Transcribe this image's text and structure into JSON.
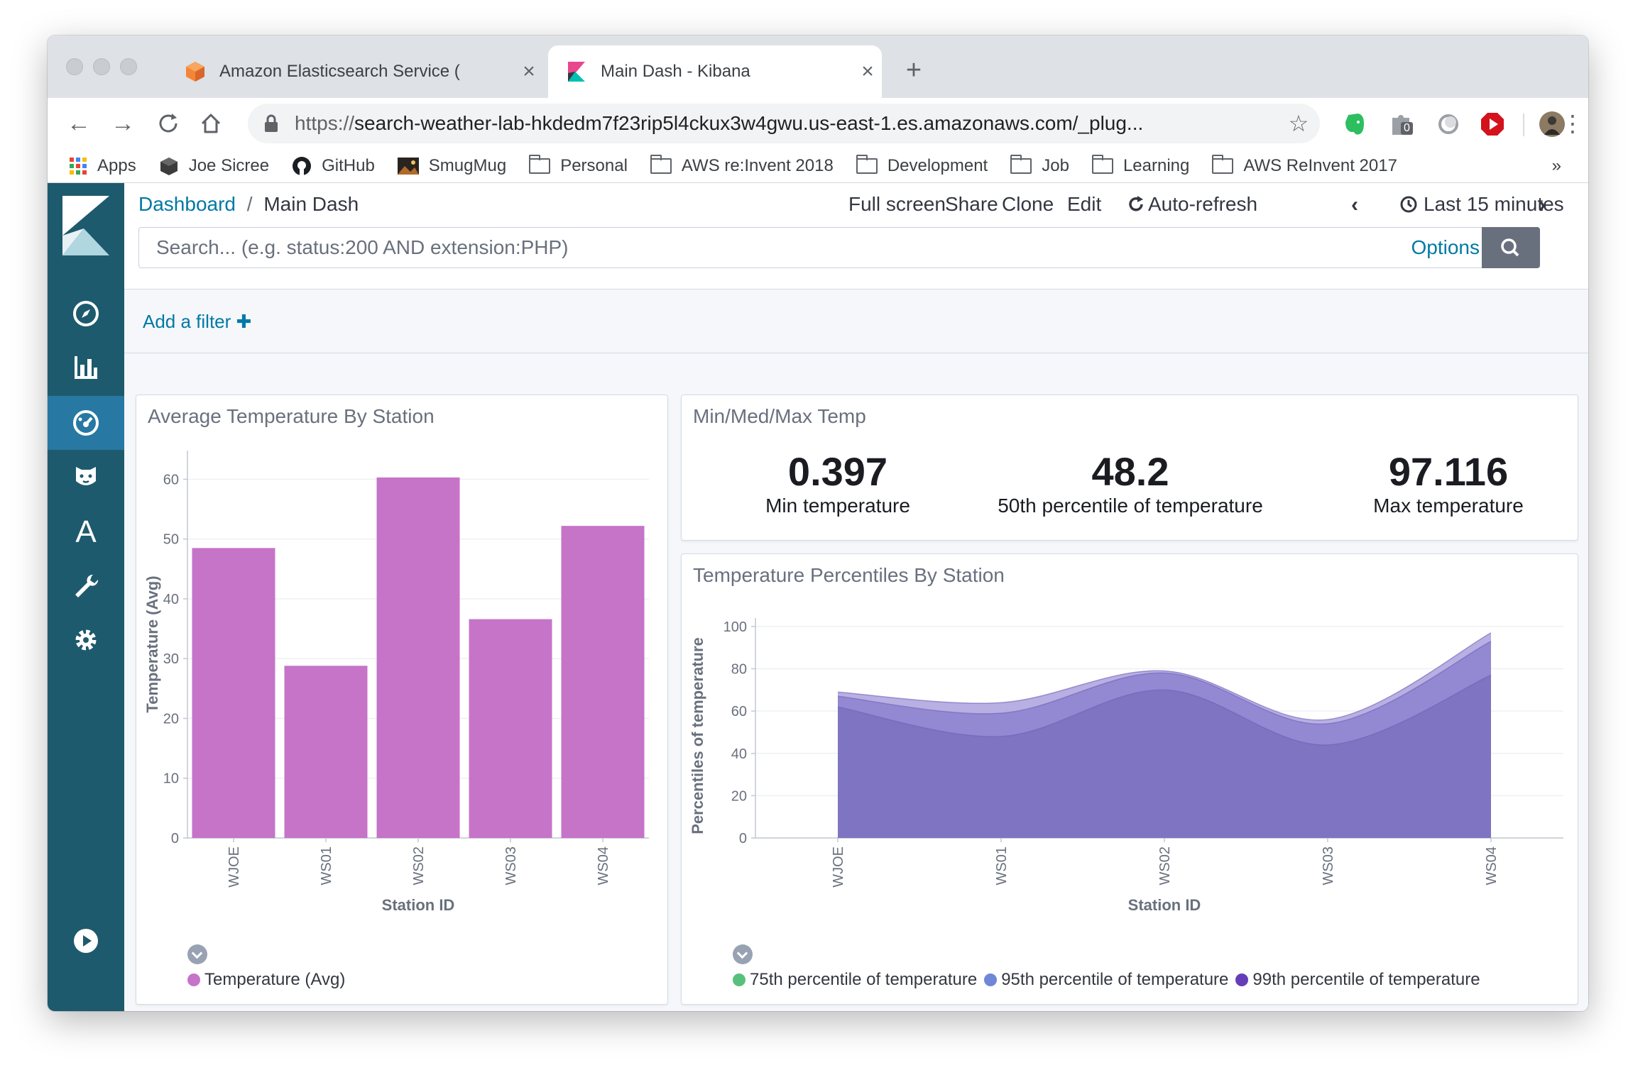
{
  "browser": {
    "tabs": [
      {
        "title": "Amazon Elasticsearch Service (",
        "active": false
      },
      {
        "title": "Main Dash - Kibana",
        "active": true
      }
    ],
    "url_scheme": "https://",
    "url_rest": "search-weather-lab-hkdedm7f23rip5l4ckux3w4gwu.us-east-1.es.amazonaws.com/_plug...",
    "extension_badge": "0",
    "bookmarks": [
      {
        "label": "Apps",
        "icon": "apps-grid-icon"
      },
      {
        "label": "Joe Sicree",
        "icon": "cube-icon"
      },
      {
        "label": "GitHub",
        "icon": "github-icon"
      },
      {
        "label": "SmugMug",
        "icon": "photo-icon"
      },
      {
        "label": "Personal",
        "icon": "folder-icon"
      },
      {
        "label": "AWS re:Invent 2018",
        "icon": "folder-icon"
      },
      {
        "label": "Development",
        "icon": "folder-icon"
      },
      {
        "label": "Job",
        "icon": "folder-icon"
      },
      {
        "label": "Learning",
        "icon": "folder-icon"
      },
      {
        "label": "AWS ReInvent 2017",
        "icon": "folder-icon"
      }
    ],
    "overflow": "»"
  },
  "kibana": {
    "breadcrumb": {
      "root": "Dashboard",
      "sep": "/",
      "current": "Main Dash"
    },
    "menu": {
      "full_screen": "Full screen",
      "share": "Share",
      "clone": "Clone",
      "edit": "Edit",
      "auto_refresh": "Auto-refresh",
      "time_range": "Last 15 minutes"
    },
    "search": {
      "placeholder": "Search... (e.g. status:200 AND extension:PHP)",
      "options": "Options"
    },
    "add_filter": "Add a filter",
    "colors": {
      "sidebar": "#1e5a6d",
      "accent": "#0079a5",
      "bar": "#c574c8",
      "area": "#8a7fcc"
    }
  },
  "panels": {
    "avg_temp": {
      "title": "Average Temperature By Station",
      "legend": "Temperature (Avg)",
      "legend_color": "#c574c8"
    },
    "metrics": {
      "title": "Min/Med/Max Temp",
      "items": [
        {
          "value": "0.397",
          "label": "Min temperature"
        },
        {
          "value": "48.2",
          "label": "50th percentile of temperature"
        },
        {
          "value": "97.116",
          "label": "Max temperature"
        }
      ]
    },
    "percentiles": {
      "title": "Temperature Percentiles By Station",
      "legend": [
        {
          "label": "75th percentile of temperature",
          "color": "#57c17b"
        },
        {
          "label": "95th percentile of temperature",
          "color": "#6f87d8"
        },
        {
          "label": "99th percentile of temperature",
          "color": "#663db8"
        }
      ]
    }
  },
  "chart_data": [
    {
      "type": "bar",
      "categories": [
        "WJOE",
        "WS01",
        "WS02",
        "WS03",
        "WS04"
      ],
      "values": [
        48.5,
        28.8,
        60.3,
        36.6,
        52.2
      ],
      "xlabel": "Station ID",
      "ylabel": "Temperature (Avg)",
      "ylim": [
        0,
        60
      ],
      "yticks": [
        0,
        10,
        20,
        30,
        40,
        50,
        60
      ],
      "grid": true,
      "color": "#c574c8"
    },
    {
      "type": "area",
      "categories": [
        "WJOE",
        "WS01",
        "WS02",
        "WS03",
        "WS04"
      ],
      "series": [
        {
          "name": "75th percentile of temperature",
          "values": [
            62,
            48,
            70,
            44,
            77
          ]
        },
        {
          "name": "95th percentile of temperature",
          "values": [
            67,
            59,
            78,
            54,
            93
          ]
        },
        {
          "name": "99th percentile of temperature",
          "values": [
            69,
            64,
            79,
            56,
            97
          ]
        }
      ],
      "xlabel": "Station ID",
      "ylabel": "Percentiles of temperature",
      "ylim": [
        0,
        100
      ],
      "yticks": [
        0,
        20,
        40,
        60,
        80,
        100
      ],
      "grid": true
    }
  ]
}
